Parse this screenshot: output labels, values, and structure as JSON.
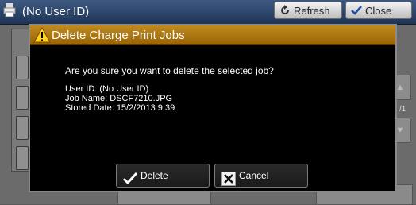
{
  "background": {
    "title": "(No User ID)",
    "refresh_label": "Refresh",
    "close_label": "Close",
    "n_fragment": "N",
    "page_fragment": "/1",
    "scroll_up_icon": "triangle-up-icon",
    "scroll_down_icon": "triangle-down-icon"
  },
  "dialog": {
    "title": "Delete Charge Print Jobs",
    "warning_icon": "warning-triangle-icon",
    "question": "Are you sure you want to delete the selected job?",
    "details": [
      "User ID: (No User ID)",
      "Job Name: DSCF7210.JPG",
      "Stored Date: 15/2/2013 9:39"
    ],
    "delete_label": "Delete",
    "cancel_label": "Cancel"
  },
  "colors": {
    "titlebar": "#b07a16",
    "dialog_bg": "#000000",
    "header_bg": "#2a4670"
  }
}
